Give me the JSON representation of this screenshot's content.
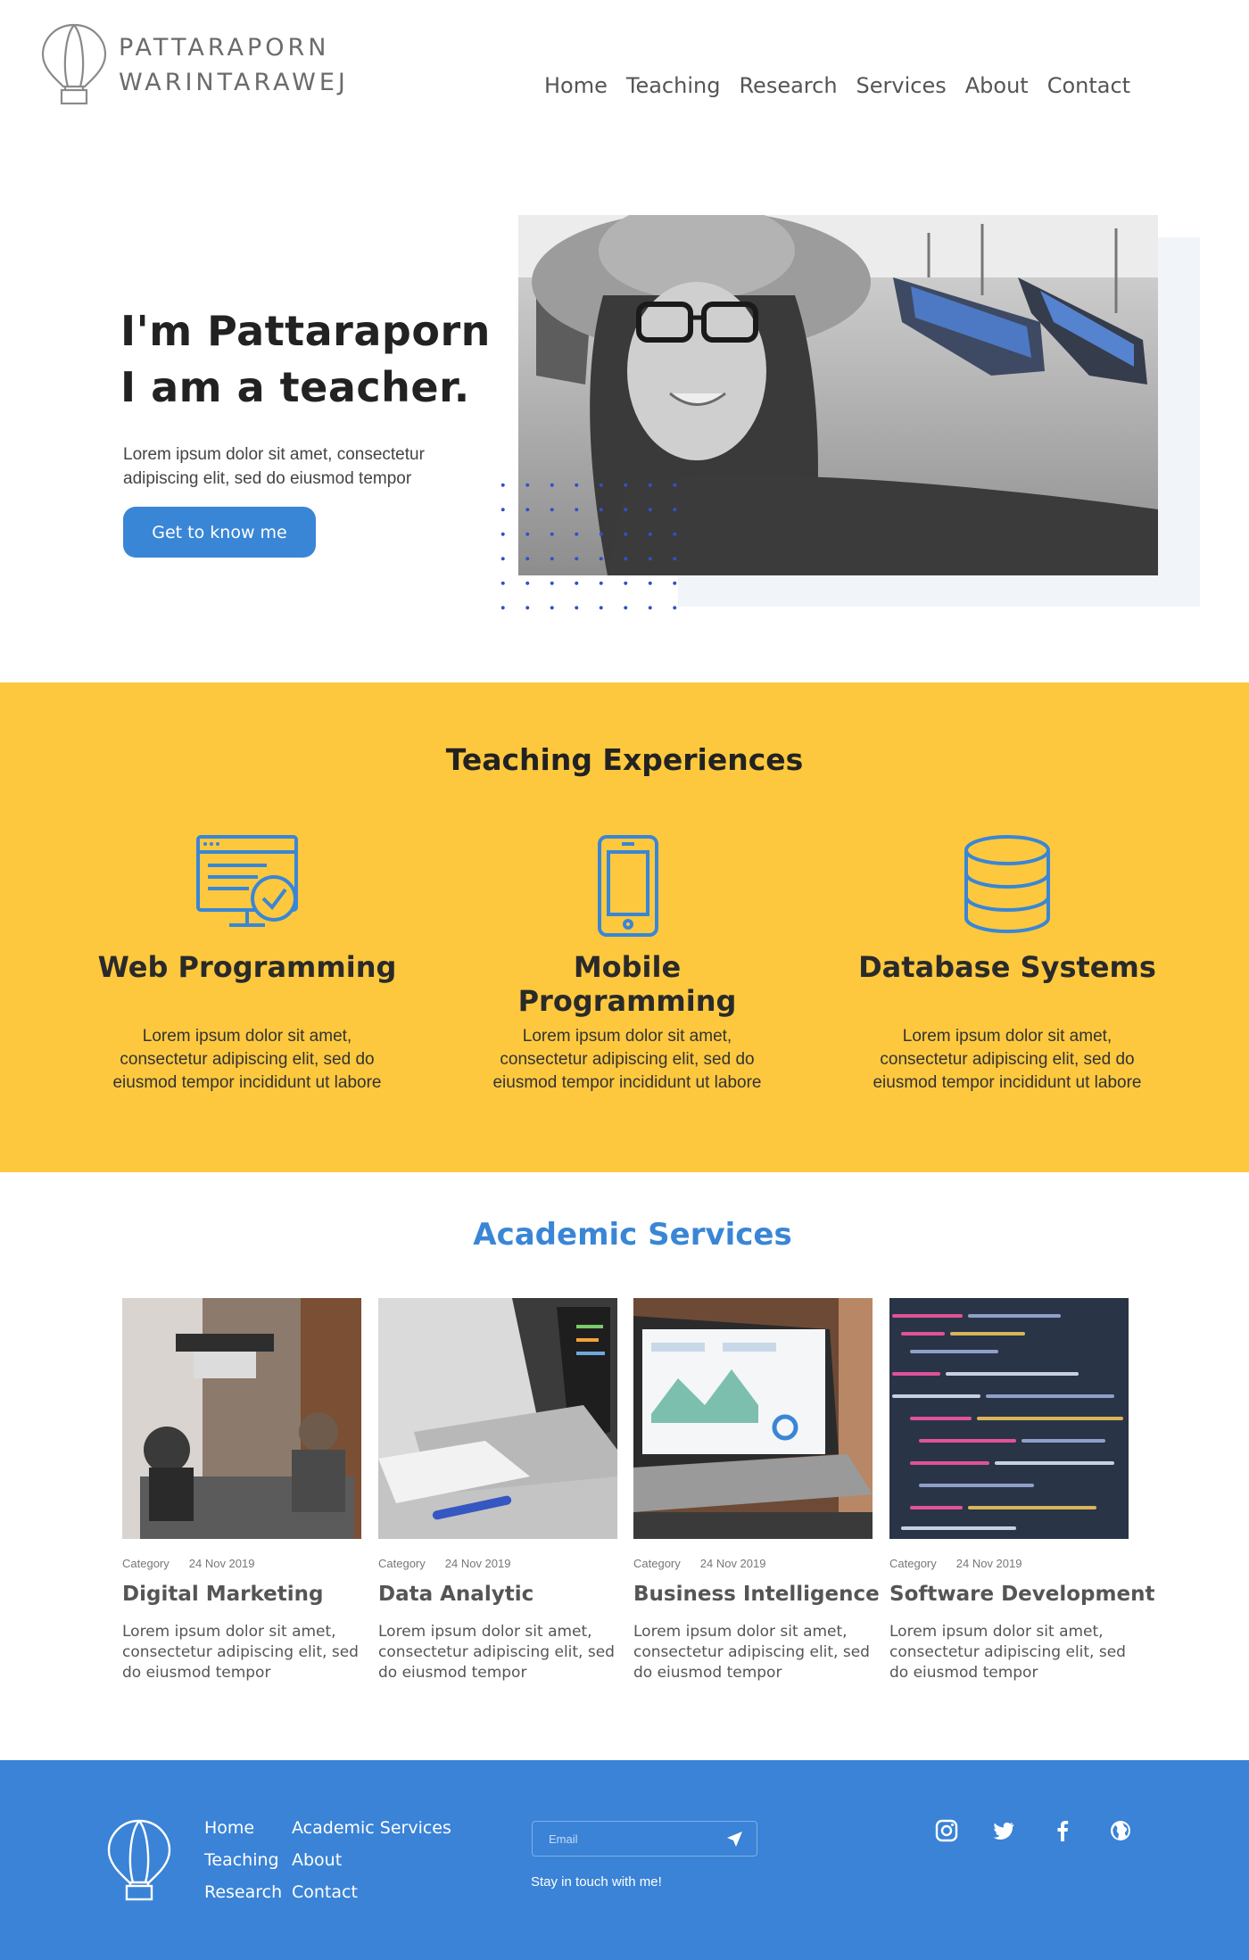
{
  "brand": {
    "name_line1": "PATTARAPORN",
    "name_line2": "WARINTARAWEJ",
    "logo_icon": "hot-air-balloon-icon"
  },
  "nav": {
    "items": [
      "Home",
      "Teaching",
      "Research",
      "Services",
      "About",
      "Contact"
    ]
  },
  "hero": {
    "title_line1": "I'm Pattaraporn",
    "title_line2": "I am a teacher.",
    "text": "Lorem ipsum dolor sit amet, consectetur adipiscing elit, sed do eiusmod tempor",
    "button": "Get to know me"
  },
  "teaching": {
    "title": "Teaching Experiences",
    "items": [
      {
        "icon": "web-browser-check-icon",
        "heading": "Web Programming",
        "text": "Lorem ipsum dolor sit amet, consectetur adipiscing elit, sed do eiusmod tempor incididunt ut labore"
      },
      {
        "icon": "smartphone-icon",
        "heading": "Mobile Programming",
        "text": "Lorem ipsum dolor sit amet, consectetur adipiscing elit, sed do eiusmod tempor incididunt ut labore"
      },
      {
        "icon": "database-icon",
        "heading": "Database Systems",
        "text": "Lorem ipsum dolor sit amet, consectetur adipiscing elit, sed do eiusmod tempor incididunt ut labore"
      }
    ]
  },
  "academic": {
    "title": "Academic Services",
    "cards": [
      {
        "category": "Category",
        "date": "24 Nov 2019",
        "title": "Digital Marketing",
        "text": "Lorem ipsum dolor sit amet, consectetur adipiscing elit, sed do eiusmod tempor"
      },
      {
        "category": "Category",
        "date": "24 Nov 2019",
        "title": "Data Analytic",
        "text": "Lorem ipsum dolor sit amet, consectetur adipiscing elit, sed do eiusmod tempor"
      },
      {
        "category": "Category",
        "date": "24 Nov 2019",
        "title": "Business Intelligence",
        "text": "Lorem ipsum dolor sit amet, consectetur adipiscing elit, sed do eiusmod tempor"
      },
      {
        "category": "Category",
        "date": "24 Nov 2019",
        "title": "Software Development",
        "text": "Lorem ipsum dolor sit amet, consectetur adipiscing elit, sed do eiusmod tempor"
      }
    ]
  },
  "footer": {
    "links": [
      "Home",
      "Academic Services",
      "Teaching",
      "About",
      "Research",
      "Contact"
    ],
    "email_placeholder": "Email",
    "tagline": "Stay in touch with me!",
    "social": [
      "instagram-icon",
      "twitter-icon",
      "facebook-icon",
      "globe-icon"
    ]
  },
  "colors": {
    "accent": "#3a86d6",
    "teaching_bg": "#fdc83e",
    "footer_bg": "#3a83d6"
  }
}
